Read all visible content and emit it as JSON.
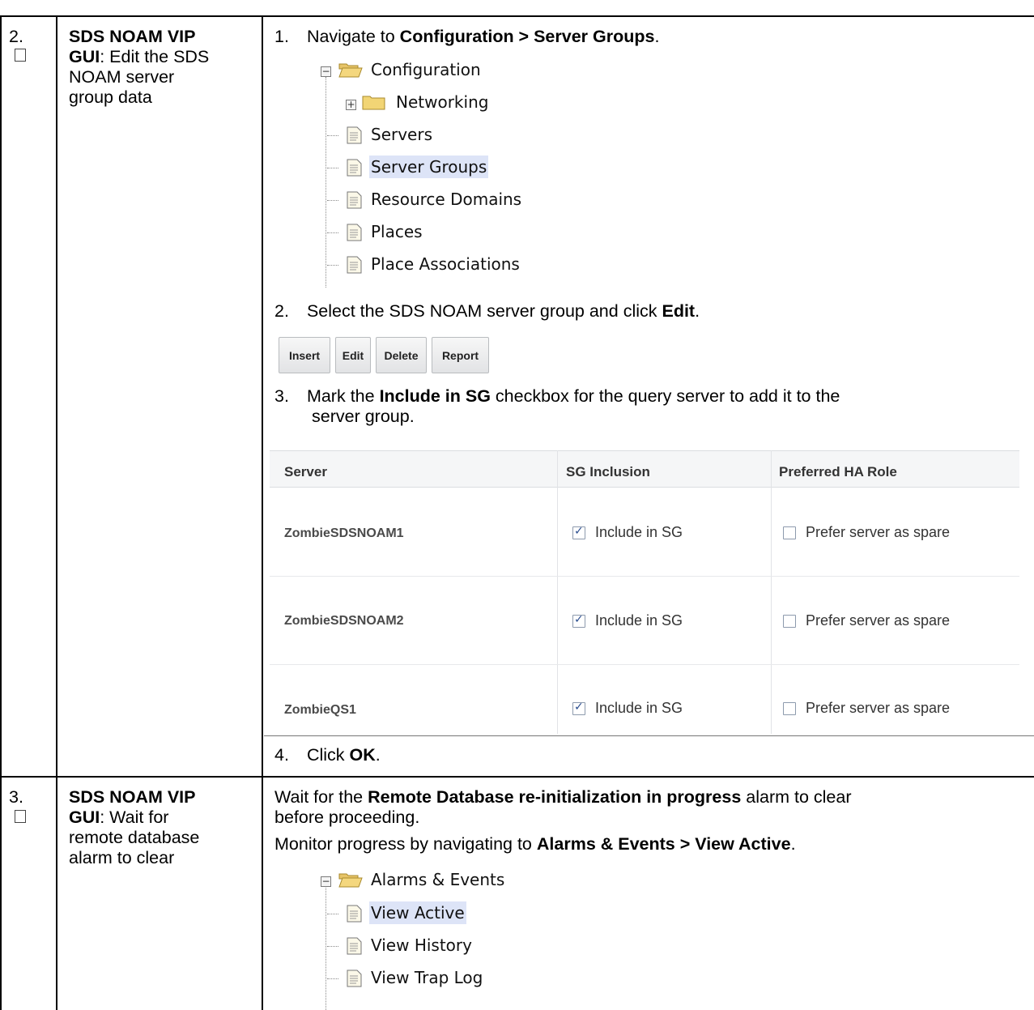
{
  "rows": [
    {
      "number": "2.",
      "title_bold": "SDS NOAM VIP GUI",
      "title_rest": ":  Edit the SDS NOAM server group data",
      "title_lines": [
        "SDS NOAM VIP",
        "GUI",
        ":  Edit the SDS",
        "NOAM server",
        "group data"
      ],
      "steps": [
        {
          "num": "1.",
          "pre": "Navigate to ",
          "bold": "Configuration > Server Groups",
          "post": "."
        },
        {
          "num": "2.",
          "pre": "Select the SDS NOAM server group and click ",
          "bold": "Edit",
          "post": "."
        },
        {
          "num": "3.",
          "pre": "Mark the ",
          "bold": "Include in SG",
          "post": " checkbox for the query server to add it to the",
          "line2": "server group."
        },
        {
          "num": "4.",
          "pre": "Click ",
          "bold": "OK",
          "post": "."
        }
      ],
      "tree": {
        "root": "Configuration",
        "items": [
          "Networking",
          "Servers",
          "Server Groups",
          "Resource Domains",
          "Places",
          "Place Associations"
        ],
        "selected": "Server Groups"
      },
      "buttons": [
        "Insert",
        "Edit",
        "Delete",
        "Report"
      ],
      "table": {
        "headers": [
          "Server",
          "SG Inclusion",
          "Preferred HA Role"
        ],
        "rows": [
          {
            "server": "ZombieSDSNOAM1",
            "inclusion": "Include in SG",
            "inclusion_checked": true,
            "role": "Prefer server as spare",
            "role_checked": false
          },
          {
            "server": "ZombieSDSNOAM2",
            "inclusion": "Include in SG",
            "inclusion_checked": true,
            "role": "Prefer server as spare",
            "role_checked": false
          },
          {
            "server": "ZombieQS1",
            "inclusion": "Include in SG",
            "inclusion_checked": true,
            "role": "Prefer server as spare",
            "role_checked": false
          }
        ]
      }
    },
    {
      "number": "3.",
      "title_lines": [
        "SDS NOAM VIP",
        "GUI",
        ":  Wait for",
        "remote database",
        "alarm to clear"
      ],
      "para1_pre": "Wait for the ",
      "para1_bold": "Remote Database re-initialization in progress",
      "para1_post": " alarm to clear",
      "para1_line2": "before proceeding.",
      "para2_pre": "Monitor progress by navigating to ",
      "para2_bold": "Alarms & Events > View Active",
      "para2_post": ".",
      "tree": {
        "root": "Alarms & Events",
        "items": [
          "View Active",
          "View History",
          "View Trap Log"
        ],
        "selected": "View Active"
      }
    }
  ]
}
